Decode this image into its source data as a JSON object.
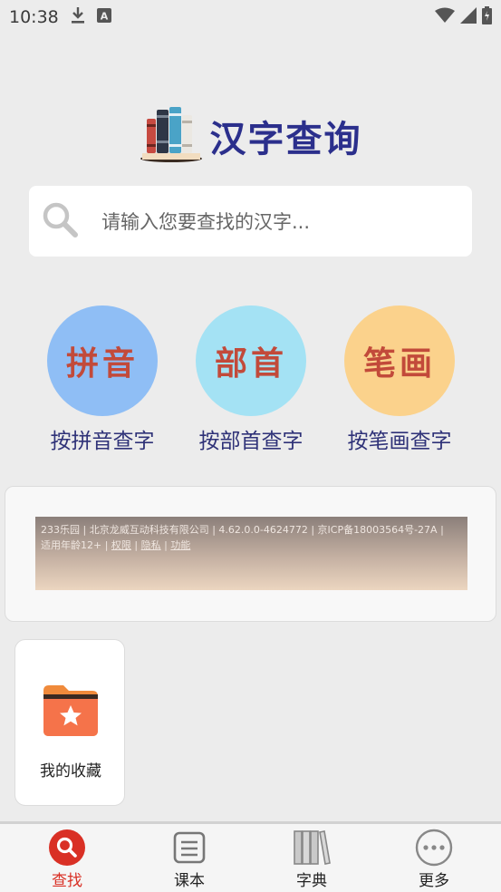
{
  "status_bar": {
    "time": "10:38"
  },
  "app": {
    "title": "汉字查询"
  },
  "search": {
    "placeholder": "请输入您要查找的汉字..."
  },
  "lookup_methods": [
    {
      "icon_text": "拼音",
      "label": "按拼音查字",
      "color": "#8fbef5"
    },
    {
      "icon_text": "部首",
      "label": "按部首查字",
      "color": "#a4e2f4"
    },
    {
      "icon_text": "笔画",
      "label": "按笔画查字",
      "color": "#fbd28c"
    }
  ],
  "ad": {
    "line1": "233乐园 | 北京龙威互动科技有限公司 | 4.62.0.0-4624772 | 京ICP备18003564号-27A |",
    "line2_prefix": "适用年龄12+ | ",
    "link_rights": "权限",
    "sep1": " | ",
    "link_privacy": "隐私",
    "sep2": " | ",
    "link_features": "功能"
  },
  "favorites": {
    "label": "我的收藏",
    "icon": "star-folder-icon"
  },
  "bottom_nav": [
    {
      "label": "查找",
      "icon": "search-icon",
      "active": true
    },
    {
      "label": "课本",
      "icon": "textbook-icon",
      "active": false
    },
    {
      "label": "字典",
      "icon": "dictionary-icon",
      "active": false
    },
    {
      "label": "更多",
      "icon": "more-icon",
      "active": false
    }
  ],
  "colors": {
    "accent": "#d93025",
    "title": "#2b2f8c"
  }
}
